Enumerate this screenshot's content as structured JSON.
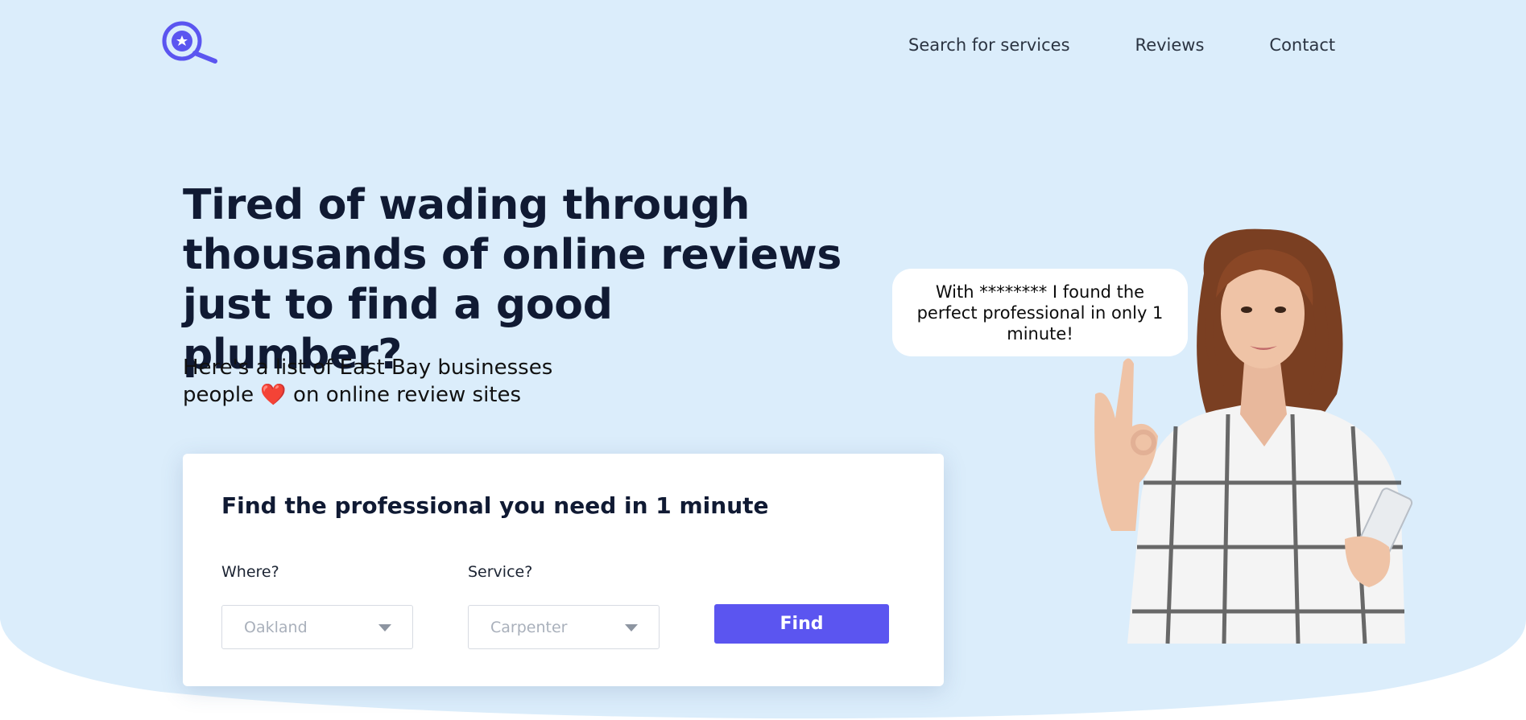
{
  "colors": {
    "hero_bg": "#dbedfb",
    "accent": "#5b55f0",
    "heading": "#101a33"
  },
  "header": {
    "logo_icon": "magnifier-star-icon",
    "nav": [
      {
        "label": "Search for services"
      },
      {
        "label": "Reviews"
      },
      {
        "label": "Contact"
      }
    ]
  },
  "hero": {
    "headline_lines": [
      "Tired of wading through",
      "thousands of online reviews",
      "just to find a good plumber?"
    ],
    "sub_line1": "Here's a list of East Bay businesses",
    "sub_line2_before": "people ",
    "sub_heart": "❤️",
    "sub_line2_after": " on online review sites"
  },
  "search_card": {
    "title": "Find the professional you need in 1 minute",
    "where_label": "Where?",
    "where_value": "Oakland",
    "service_label": "Service?",
    "service_value": "Carpenter",
    "find_label": "Find"
  },
  "testimonial": {
    "text": "With ******** I found the perfect professional in only 1 minute!"
  }
}
